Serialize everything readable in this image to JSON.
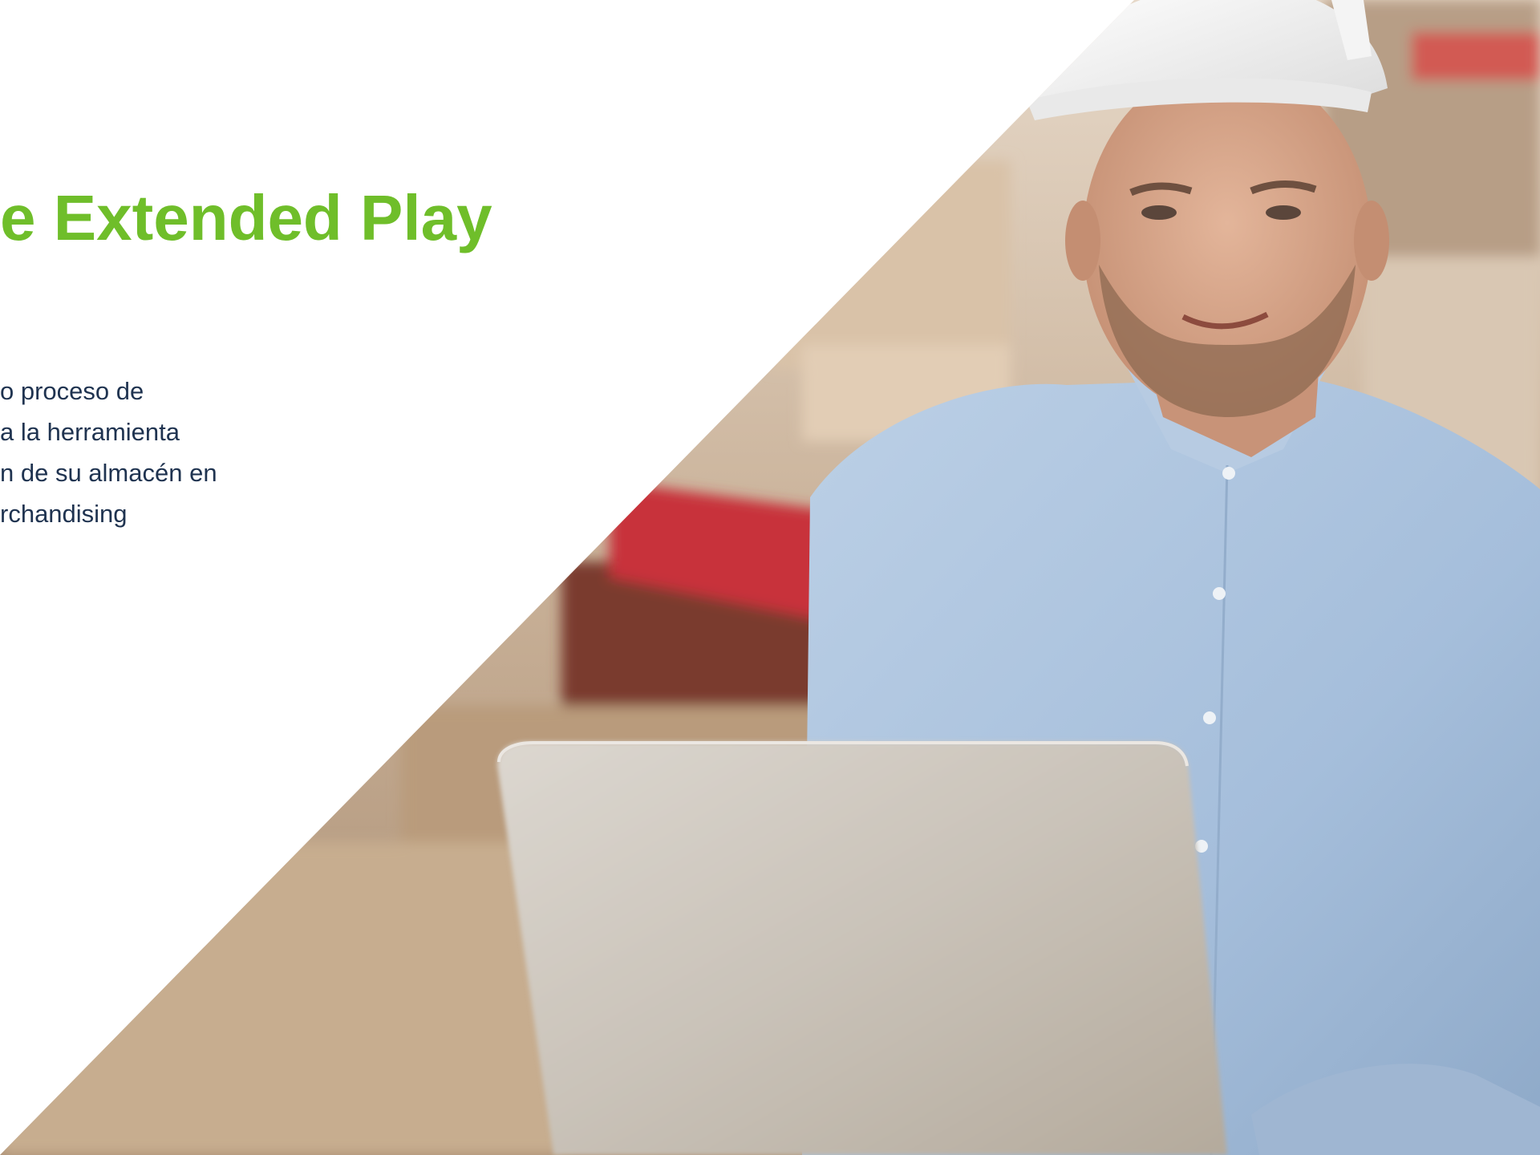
{
  "slide": {
    "title": "e Extended Play",
    "body_lines": [
      "o proceso de",
      "a la herramienta",
      "n de su almacén en",
      "rchandising"
    ]
  },
  "photo": {
    "description_icon": "warehouse-worker-photo"
  },
  "colors": {
    "title_green": "#6fbe2a",
    "body_navy": "#1f3350",
    "shirt_blue": "#a9c2dd",
    "laptop_silver": "#c9c4bd",
    "shelf_red": "#c8303a"
  }
}
